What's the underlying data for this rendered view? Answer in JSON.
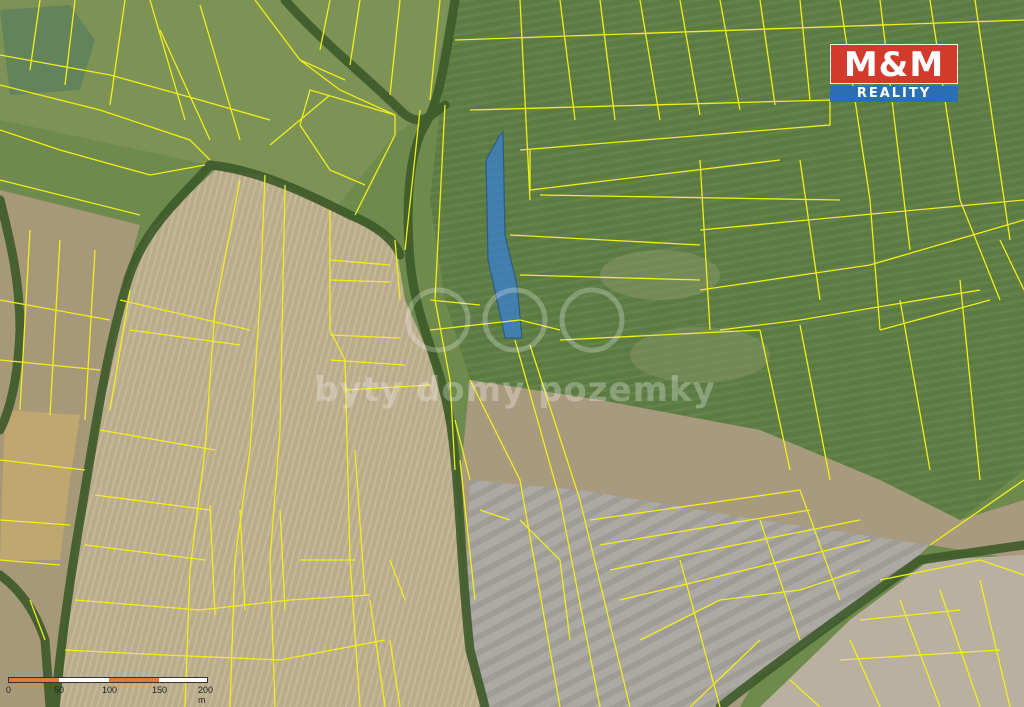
{
  "map": {
    "type": "cadastral-aerial-orthophoto",
    "parcel_line_color": "#f0ef1a",
    "highlight_parcel_color": "#3a7fd0",
    "field_colors": {
      "green_field": "#5f7d45",
      "stubble_field": "#b8a98a",
      "plowed_field": "#a9a59f",
      "tree_line": "#3f5a2a"
    }
  },
  "logo": {
    "main": "M&M",
    "sub": "REALITY",
    "main_color": "#d23a2c",
    "sub_color": "#2a6fb4"
  },
  "watermark": {
    "text": "byty domy pozemky"
  },
  "scale": {
    "labels": [
      "0",
      "50",
      "100",
      "150",
      "200 m"
    ],
    "colors": [
      "#e07a3a",
      "#ffffff"
    ]
  }
}
